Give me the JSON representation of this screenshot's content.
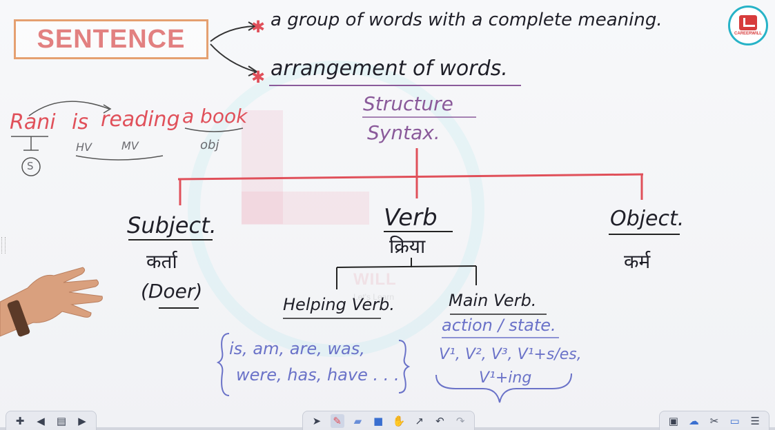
{
  "board": {
    "title_box": "SENTENCE",
    "definition_1": "a group of words with a complete meaning.",
    "definition_2": "arrangement of words.",
    "structure": "Structure",
    "syntax": "Syntax.",
    "example": {
      "w1": "Rani",
      "w2": "is",
      "w3": "reading",
      "w4": "a book",
      "s_mark": "S",
      "hv": "HV",
      "mv": "MV",
      "obj": "obj"
    },
    "subject": {
      "label": "Subject.",
      "hindi": "कर्ता",
      "doer": "(Doer)"
    },
    "verb": {
      "label": "Verb",
      "hindi": "क्रिया"
    },
    "object": {
      "label": "Object.",
      "hindi": "कर्म"
    },
    "helping_verb": {
      "label": "Helping Verb.",
      "line1": "is, am, are, was,",
      "line2": "were, has, have . . ."
    },
    "main_verb": {
      "label": "Main Verb.",
      "action": "action / state.",
      "forms": "V¹, V², V³, V¹+s/es,",
      "ing": "V¹+ing"
    },
    "watermark": {
      "text": "WILL",
      "sub": "Let's Learn"
    }
  },
  "logo": {
    "text": "CAREERWILL"
  },
  "colors": {
    "red_ink": "#e0505a",
    "purple_ink": "#8a5a9a",
    "blue_ink": "#6a72c8",
    "dark_ink": "#1f1f28",
    "box_border": "#e5a070",
    "logo_ring": "#27b3c7"
  },
  "toolbar": {
    "left": [
      "add-icon",
      "prev-page-icon",
      "page-thumbnail-icon",
      "next-page-icon"
    ],
    "center": [
      "select-arrow-icon",
      "pen-icon",
      "highlighter-icon",
      "shape-icon",
      "hand-pan-icon",
      "laser-icon",
      "undo-icon",
      "redo-icon"
    ],
    "right": [
      "gallery-icon",
      "cloud-icon",
      "tools-icon",
      "screen-icon",
      "menu-icon"
    ]
  }
}
